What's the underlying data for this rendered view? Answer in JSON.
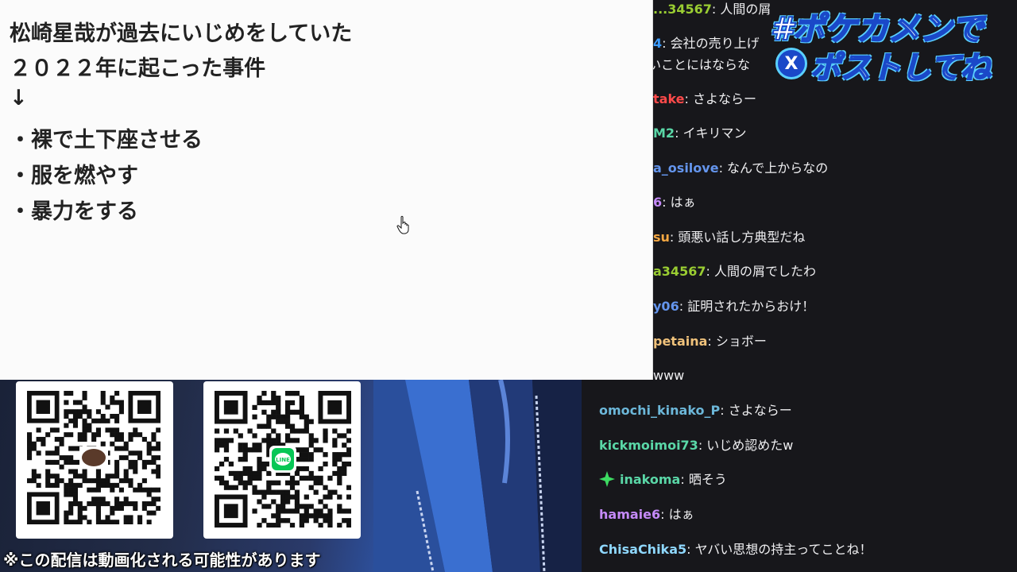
{
  "notes": {
    "lines": [
      "松崎星哉が過去にいじめをしていた",
      "２０２２年に起こった事件",
      "↓",
      "・裸で土下座させる",
      "・服を燃やす",
      "・暴力をする"
    ]
  },
  "hashtag": {
    "line1": "#ポケカメンで",
    "line2": "ポストしてね",
    "x_label": "X"
  },
  "disclaimer": "※この配信は動画化される可能性があります",
  "qr": {
    "left_icon": "speech-bubble-icon",
    "right_icon": "line-app-icon",
    "right_icon_text": "LINE"
  },
  "chat": {
    "messages": [
      {
        "user": "...34567",
        "color": "#9acd32",
        "text": "人間の屑",
        "partial": true
      },
      {
        "user": "4",
        "color": "#3c9cff",
        "text": "会社の売り上げ"
      },
      {
        "user": "",
        "color": "#efeff1",
        "text": "いことにはならな"
      },
      {
        "user": "take",
        "color": "#ff4a4a",
        "text": "さよならー"
      },
      {
        "user": "M2",
        "color": "#5ad7a7",
        "text": "イキリマン"
      },
      {
        "user": "a_osilove",
        "color": "#6495ed",
        "text": "なんで上からなの"
      },
      {
        "user": "6",
        "color": "#c58af9",
        "text": "はぁ"
      },
      {
        "user": "su",
        "color": "#f4a742",
        "text": "頭悪い話し方典型だね"
      },
      {
        "user": "a34567",
        "color": "#9acd32",
        "text": "人間の屑でしたわ"
      },
      {
        "user": "y06",
        "color": "#6495ed",
        "text": "証明されたからおけ！"
      },
      {
        "user": "petaina",
        "color": "#f0c27b",
        "text": "ショボー"
      },
      {
        "user": "",
        "color": "#6495ed",
        "text": "www"
      },
      {
        "user": "omochi_kinako_P",
        "color": "#6cb7d9",
        "text": "さよならー"
      },
      {
        "user": "kickmoimoi73",
        "color": "#5ad7a7",
        "text": "いじめ認めたw"
      },
      {
        "user": "inakoma",
        "color": "#5ad7a7",
        "text": "晒そう",
        "badge": "green-star-icon"
      },
      {
        "user": "hamaie6",
        "color": "#c58af9",
        "text": "はぁ"
      },
      {
        "user": "ChisaChika5",
        "color": "#8fd8ff",
        "text": "ヤバい思想の持主ってことね！"
      }
    ]
  }
}
